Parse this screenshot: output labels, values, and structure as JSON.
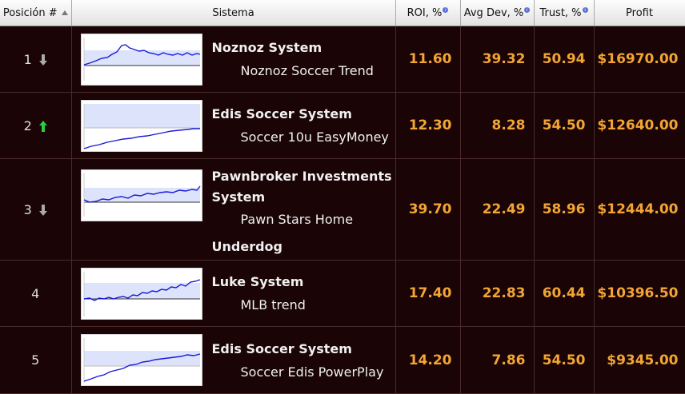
{
  "header": {
    "position": "Posición #",
    "system": "Sistema",
    "roi": "ROI, %",
    "avgdev": "Avg Dev, %",
    "trust": "Trust, %",
    "profit": "Profit"
  },
  "rows": [
    {
      "pos": "1",
      "trend": "down",
      "system": "Noznoz System",
      "strategy": "Noznoz Soccer Trend",
      "roi": "11.60",
      "avgdev": "39.32",
      "trust": "50.94",
      "profit": "$16970.00"
    },
    {
      "pos": "2",
      "trend": "up",
      "system": "Edis Soccer System",
      "strategy": "Soccer 10u EasyMoney",
      "roi": "12.30",
      "avgdev": "8.28",
      "trust": "54.50",
      "profit": "$12640.00"
    },
    {
      "pos": "3",
      "trend": "down",
      "system": "Pawnbroker Investments System",
      "strategy": "Pawn Stars Home",
      "strategy_cont": "Underdog",
      "roi": "39.70",
      "avgdev": "22.49",
      "trust": "58.96",
      "profit": "$12444.00"
    },
    {
      "pos": "4",
      "trend": "none",
      "system": "Luke System",
      "strategy": "MLB trend",
      "roi": "17.40",
      "avgdev": "22.83",
      "trust": "60.44",
      "profit": "$10396.50"
    },
    {
      "pos": "5",
      "trend": "none",
      "system": "Edis Soccer System",
      "strategy": "Soccer Edis PowerPlay",
      "roi": "14.20",
      "avgdev": "7.86",
      "trust": "54.50",
      "profit": "$9345.00"
    }
  ],
  "icons": {
    "down": "arrow-down-icon",
    "up": "arrow-up-icon"
  },
  "colors": {
    "number": "#f2a534",
    "up": "#2ecc40",
    "down": "#aaaaaa",
    "line": "#1a1adb"
  }
}
